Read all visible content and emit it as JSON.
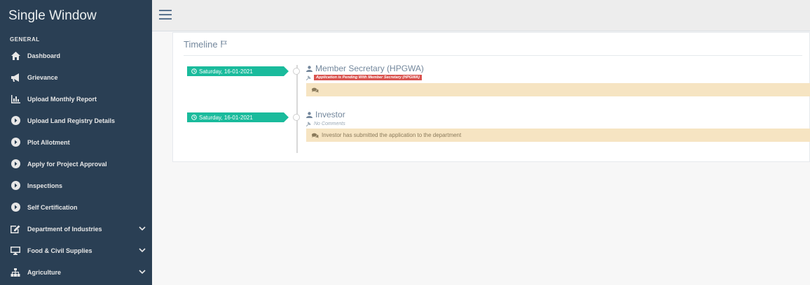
{
  "app": {
    "title": "Single Window"
  },
  "sidebar": {
    "section": "GENERAL",
    "items": [
      {
        "label": "Dashboard",
        "icon": "home-icon"
      },
      {
        "label": "Grievance",
        "icon": "bullhorn-icon"
      },
      {
        "label": "Upload Monthly Report",
        "icon": "bar-chart-icon"
      },
      {
        "label": "Upload Land Registry Details",
        "icon": "circle-arrow-icon"
      },
      {
        "label": "Plot Allotment",
        "icon": "circle-arrow-icon"
      },
      {
        "label": "Apply for Project Approval",
        "icon": "circle-arrow-icon"
      },
      {
        "label": "Inspections",
        "icon": "circle-arrow-icon"
      },
      {
        "label": "Self Certification",
        "icon": "circle-arrow-icon"
      },
      {
        "label": "Department of Industries",
        "icon": "edit-icon",
        "has_submenu": true
      },
      {
        "label": "Food & Civil Supplies",
        "icon": "desktop-icon",
        "has_submenu": true
      },
      {
        "label": "Agriculture",
        "icon": "sitemap-icon",
        "has_submenu": true
      }
    ]
  },
  "panel": {
    "title": "Timeline",
    "entries": [
      {
        "date": "Saturday, 16-01-2021",
        "name": "Member Secretary (HPGWA)",
        "status": "Application is Pending With Member Secretary (HPGWA)",
        "message": ""
      },
      {
        "date": "Saturday, 16-01-2021",
        "name": "Investor",
        "status": "No Comments",
        "message": "Investor has submitted the application to the department"
      }
    ]
  },
  "colors": {
    "sidebar": "#2a3f54",
    "accent": "#1abb9c",
    "badge": "#d9534f",
    "message_bg": "#f6e4c2"
  }
}
